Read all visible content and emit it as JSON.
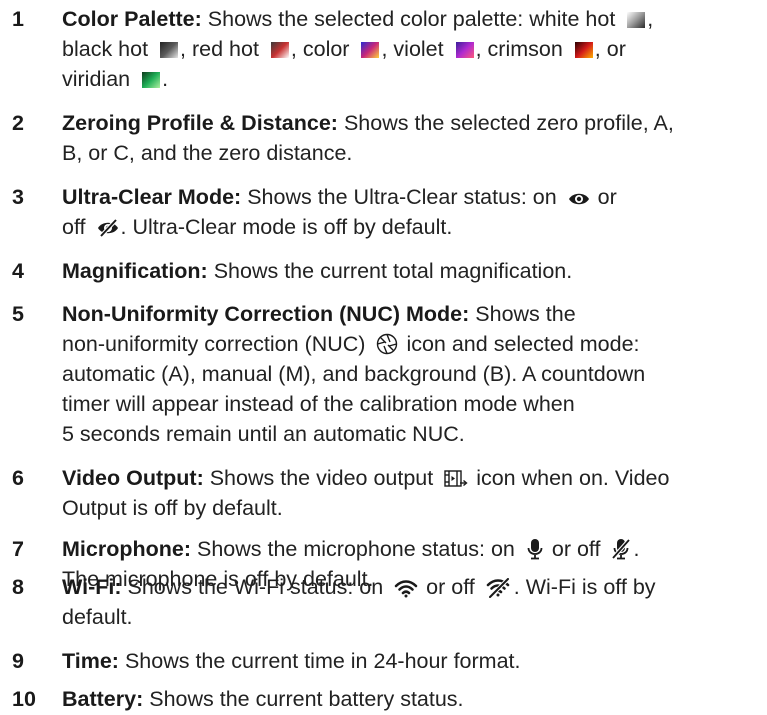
{
  "items": [
    {
      "num": "1",
      "title": "Color Palette:",
      "text": {
        "a": "Shows the selected color palette: white hot",
        "b": ",",
        "c": "black hot",
        "d": ", red hot",
        "e": ", color",
        "f": ", violet",
        "g": ", crimson",
        "h": ", or",
        "i": "viridian",
        "j": "."
      },
      "swatches": {
        "white_hot": [
          "#ffffff",
          "#9a9a9a",
          "#2a2a2a"
        ],
        "black_hot": [
          "#222222",
          "#5a5a5a",
          "#e6e6e6"
        ],
        "red_hot": [
          "#3a3a3a",
          "#c83232",
          "#ffffff"
        ],
        "color": [
          "#2b2bd0",
          "#c8287a",
          "#ffd23a"
        ],
        "violet": [
          "#3a1f9a",
          "#b02ad0",
          "#ff5a7a"
        ],
        "crimson": [
          "#2a0000",
          "#d21a1a",
          "#ffb000"
        ],
        "viridian": [
          "#0e3a1c",
          "#1fae57",
          "#aef0a0"
        ]
      }
    },
    {
      "num": "2",
      "title": "Zeroing Profile & Distance:",
      "text": {
        "a": "Shows the selected zero profile, A,",
        "b": "B, or C, and the zero distance."
      }
    },
    {
      "num": "3",
      "title": "Ultra-Clear Mode:",
      "text": {
        "a": "Shows the Ultra-Clear status: on",
        "b": "or",
        "c": "off",
        "d": ". Ultra-Clear mode is off by default."
      },
      "icons": [
        "eye-icon",
        "eye-off-icon"
      ]
    },
    {
      "num": "4",
      "title": "Magnification:",
      "text": {
        "a": "Shows the current total magnification."
      }
    },
    {
      "num": "5",
      "title": "Non-Uniformity Correction (NUC) Mode:",
      "text": {
        "a": "Shows the",
        "b": "non-uniformity correction (NUC)",
        "c": "icon and selected mode:",
        "d": "automatic (A), manual (M), and background (B). A countdown",
        "e": "timer will appear instead of the calibration mode when",
        "f": "5 seconds remain until an automatic NUC."
      },
      "icons": [
        "nuc-shutter-icon"
      ]
    },
    {
      "num": "6",
      "title": "Video Output:",
      "text": {
        "a": "Shows the video output",
        "b": "icon when on. Video",
        "c": "Output is off by default."
      },
      "icons": [
        "video-output-icon"
      ]
    },
    {
      "num": "7",
      "title": "Microphone:",
      "text": {
        "a": "Shows the microphone status: on",
        "b": "or off",
        "c": ".",
        "d": "The microphone is off by default."
      },
      "icons": [
        "microphone-icon",
        "microphone-off-icon"
      ]
    },
    {
      "num": "8",
      "title": "Wi-Fi:",
      "text": {
        "a": "Shows the Wi-Fi status: on",
        "b": "or off",
        "c": ". Wi-Fi is off by",
        "d": "default."
      },
      "icons": [
        "wifi-icon",
        "wifi-off-icon"
      ]
    },
    {
      "num": "9",
      "title": "Time:",
      "text": {
        "a": "Shows the current time in 24-hour format."
      }
    },
    {
      "num": "10",
      "title": "Battery:",
      "text": {
        "a": "Shows the current battery status."
      }
    }
  ]
}
